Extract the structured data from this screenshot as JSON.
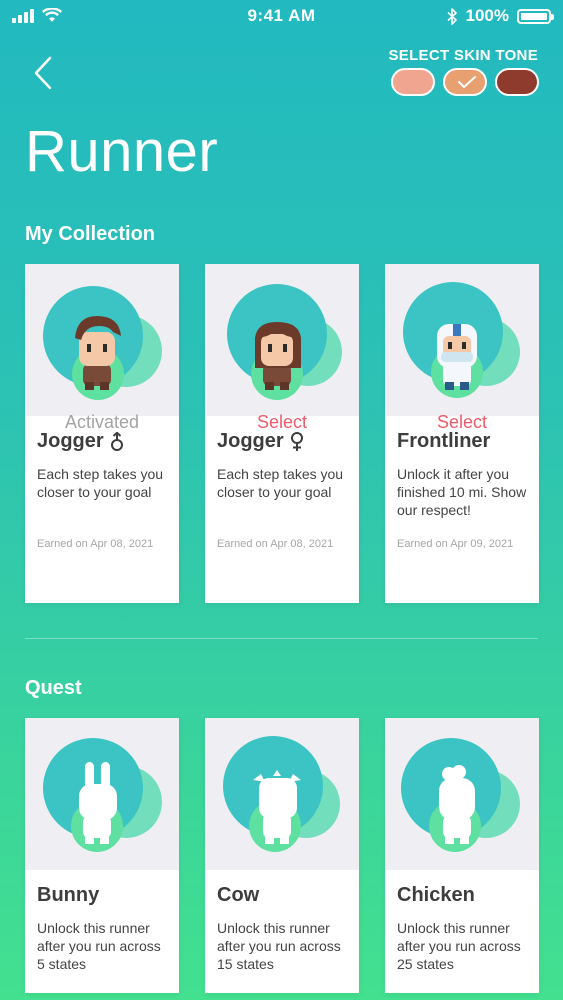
{
  "status_bar": {
    "time": "9:41 AM",
    "battery": "100%"
  },
  "header": {
    "skin_tone_label": "SELECT SKIN TONE",
    "skin_tones": [
      "#f0a590",
      "#e8a070",
      "#8e3a2c"
    ],
    "selected_skin_tone": 1,
    "title": "Runner"
  },
  "collection": {
    "title": "My Collection",
    "cards": [
      {
        "name": "Jogger",
        "gender": "male",
        "description": "Each step takes you closer to your goal",
        "earned": "Earned on Apr 08, 2021",
        "action": "Activated"
      },
      {
        "name": "Jogger",
        "gender": "female",
        "description": "Each step takes you closer to your goal",
        "earned": "Earned on Apr 08, 2021",
        "action": "Select"
      },
      {
        "name": "Frontliner",
        "gender": "",
        "description": "Unlock it after you finished 10 mi. Show our respect!",
        "earned": "Earned on Apr 09, 2021",
        "action": "Select"
      }
    ]
  },
  "quest": {
    "title": "Quest",
    "cards": [
      {
        "name": "Bunny",
        "description": "Unlock this runner after you run across 5 states"
      },
      {
        "name": "Cow",
        "description": "Unlock this runner after you run across 15 states"
      },
      {
        "name": "Chicken",
        "description": "Unlock this runner after you run across 25 states"
      }
    ]
  },
  "colors": {
    "accent": "#f05a6a",
    "teal": "#3cc8c2",
    "green": "#5ee0a0"
  }
}
